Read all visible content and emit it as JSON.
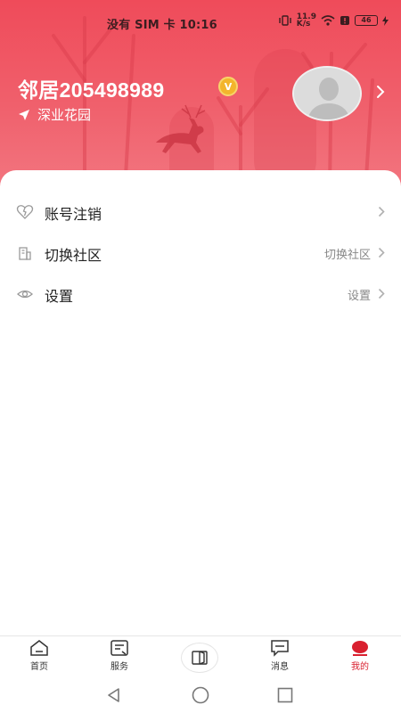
{
  "status_bar": {
    "carrier_time": "没有 SIM 卡 10:16",
    "speed": "11.9",
    "speed_unit": "K/s",
    "battery": "46"
  },
  "profile": {
    "username": "邻居205498989",
    "vip_badge": "V",
    "location": "深业花园"
  },
  "menu": [
    {
      "label": "账号注销",
      "value": "",
      "icon": "heart-broken-icon"
    },
    {
      "label": "切换社区",
      "value": "切换社区",
      "icon": "building-icon"
    },
    {
      "label": "设置",
      "value": "设置",
      "icon": "eye-settings-icon"
    }
  ],
  "tabs": [
    {
      "label": "首页",
      "icon": "home-icon"
    },
    {
      "label": "服务",
      "icon": "service-icon"
    },
    {
      "label": "",
      "icon": "door-icon"
    },
    {
      "label": "消息",
      "icon": "message-icon"
    },
    {
      "label": "我的",
      "icon": "profile-icon"
    }
  ],
  "colors": {
    "header": "#ef4b5a",
    "accent": "#d9202f",
    "vip": "#f3b52c"
  }
}
